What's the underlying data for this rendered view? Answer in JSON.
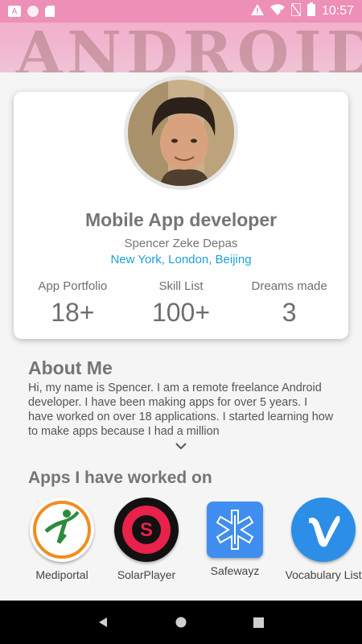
{
  "status_bar": {
    "time": "10:57",
    "left_icons": [
      "a-icon",
      "circle-icon",
      "sd-card-icon"
    ],
    "right_icons": [
      "warning-icon",
      "wifi-icon",
      "no-sim-icon",
      "battery-icon"
    ]
  },
  "profile": {
    "title": "Mobile App developer",
    "name": "Spencer Zeke Depas",
    "cities": "New York, London, Beijing",
    "stats": [
      {
        "label": "App Portfolio",
        "value": "18+"
      },
      {
        "label": "Skill List",
        "value": "100+"
      },
      {
        "label": "Dreams made",
        "value": "3"
      }
    ]
  },
  "about": {
    "title": "About Me",
    "text": "Hi, my name is Spencer. I am a remote freelance Android developer. I have been making apps for over 5 years. I have worked on over 18 applications. I started learning how to make apps because I had a million"
  },
  "apps": {
    "title": "Apps I have worked on",
    "items": [
      {
        "label": "Mediportal",
        "icon": "mediportal-icon",
        "color": "#ffffff"
      },
      {
        "label": "SolarPlayer",
        "icon": "solarplayer-icon",
        "color": "#e8224a"
      },
      {
        "label": "Safewayz",
        "icon": "safewayz-icon",
        "color": "#3f8ef0"
      },
      {
        "label": "Vocabulary List",
        "icon": "vocabulary-icon",
        "color": "#2c8ee6"
      }
    ]
  },
  "colors": {
    "accent": "#1ea0d7",
    "header_pink": "#ed8fb6",
    "text_gray": "#757575"
  }
}
